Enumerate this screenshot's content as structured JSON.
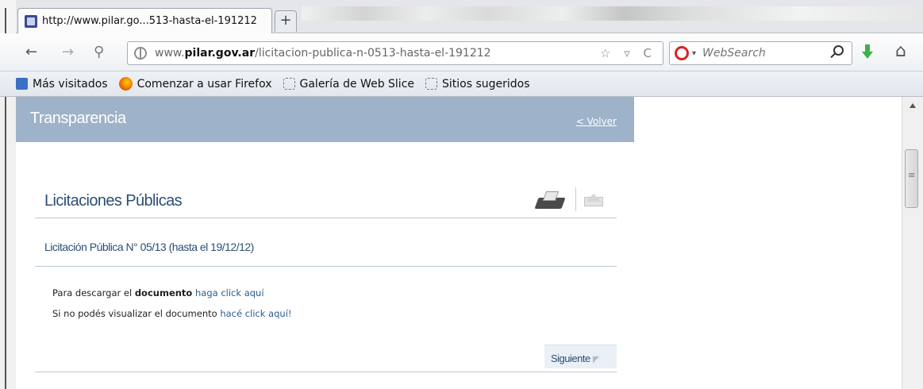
{
  "browser": {
    "tab": {
      "title": "http://www.pilar.go...513-hasta-el-191212"
    },
    "new_tab_label": "+",
    "nav": {
      "back": "←",
      "forward": "→",
      "history": "⚲"
    },
    "url": {
      "prefix": "www.",
      "host": "pilar.gov.ar",
      "path": "/licitacion-publica-n-0513-hasta-el-191212"
    },
    "url_icons": "☆ ▿ C",
    "search": {
      "placeholder": "WebSearch",
      "caret": "▾"
    },
    "home": "⌂",
    "bookmarks": [
      {
        "label": "Más visitados",
        "icon": "search-icon"
      },
      {
        "label": "Comenzar a usar Firefox",
        "icon": "firefox-icon"
      },
      {
        "label": "Galería de Web Slice",
        "icon": "webslice-icon"
      },
      {
        "label": "Sitios sugeridos",
        "icon": "webslice-icon"
      }
    ]
  },
  "page": {
    "banner": {
      "title": "Transparencia",
      "back_link": "< Volver"
    },
    "section_title": "Licitaciones Públicas",
    "item_title": "Licitación Pública N° 05/13 (hasta el 19/12/12)",
    "download": {
      "pre": "Para descargar el ",
      "bold": "documento",
      "link": " haga click aquí"
    },
    "view": {
      "pre": "Si no podés visualizar el documento ",
      "link": "hacé click aquí!"
    },
    "next": {
      "label": "Siguiente",
      "chevron": "◤"
    }
  }
}
